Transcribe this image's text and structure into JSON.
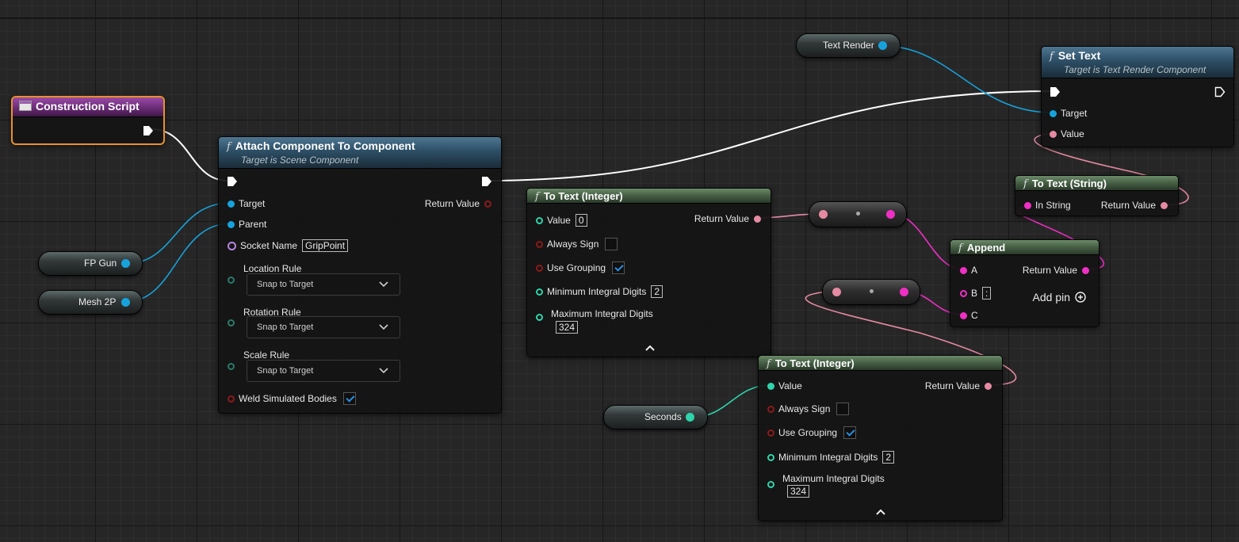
{
  "colors": {
    "exec": "#ffffff",
    "object": "#17a2dc",
    "text": "#e58aa2",
    "string": "#f02fc4",
    "integer": "#2ed4ac",
    "bool": "#8c1a1a",
    "name": "#b586e0",
    "selection": "#e8912a"
  },
  "nodes": {
    "construction_script": {
      "title": "Construction Script"
    },
    "attach": {
      "title": "Attach Component To Component",
      "subtitle": "Target is Scene Component",
      "target": "Target",
      "parent": "Parent",
      "socket_name": "Socket Name",
      "socket_value": "GripPoint",
      "return_value": "Return Value",
      "location_rule": "Location Rule",
      "rotation_rule": "Rotation Rule",
      "scale_rule": "Scale Rule",
      "rule_value": "Snap to Target",
      "weld": "Weld Simulated Bodies",
      "weld_checked": true
    },
    "to_text_1": {
      "title": "To Text (Integer)",
      "value": "Value",
      "value_default": "0",
      "return_value": "Return Value",
      "always_sign": "Always Sign",
      "use_grouping": "Use Grouping",
      "min_digits": "Minimum Integral Digits",
      "min_digits_value": "2",
      "max_digits": "Maximum Integral Digits",
      "max_digits_value": "324"
    },
    "to_text_2": {
      "title": "To Text (Integer)",
      "value": "Value",
      "return_value": "Return Value",
      "always_sign": "Always Sign",
      "use_grouping": "Use Grouping",
      "min_digits": "Minimum Integral Digits",
      "min_digits_value": "2",
      "max_digits": "Maximum Integral Digits",
      "max_digits_value": "324"
    },
    "set_text": {
      "title": "Set Text",
      "subtitle": "Target is Text Render Component",
      "target": "Target",
      "value": "Value"
    },
    "to_text_string": {
      "title": "To Text (String)",
      "in_string": "In String",
      "return_value": "Return Value"
    },
    "append": {
      "title": "Append",
      "a": "A",
      "b": "B",
      "b_default": ":",
      "c": "C",
      "return_value": "Return Value",
      "add_pin": "Add pin"
    }
  },
  "variables": {
    "fp_gun": "FP Gun",
    "mesh_2p": "Mesh 2P",
    "text_render": "Text Render",
    "seconds": "Seconds"
  }
}
